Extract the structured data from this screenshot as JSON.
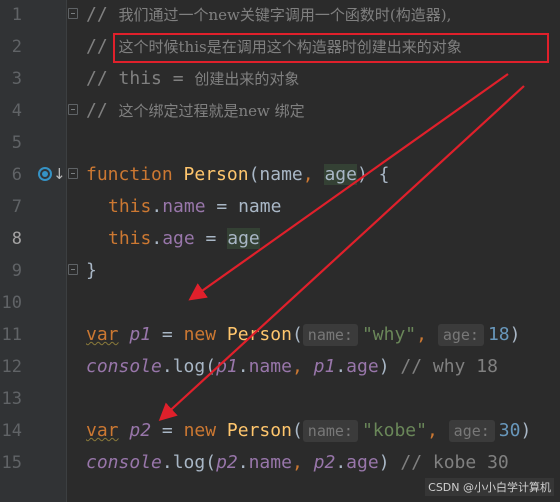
{
  "editor": {
    "lines": [
      {
        "n": "1",
        "c1": "// ",
        "t": "我们通过一个new关键字调用一个函数时(构造器),"
      },
      {
        "n": "2",
        "c1": "// ",
        "t": "这个时候this是在调用这个构造器时创建出来的对象"
      },
      {
        "n": "3",
        "c1": "// ",
        "c2": "this",
        "c3": " = ",
        "t": "创建出来的对象"
      },
      {
        "n": "4",
        "c1": "// ",
        "t": "这个绑定过程就是new 绑定"
      },
      {
        "n": "5"
      },
      {
        "n": "6",
        "kw": "function",
        "fn": "Person",
        "p1": "name",
        "p2": "age"
      },
      {
        "n": "7",
        "self": "this",
        "prop": "name",
        "val": "name"
      },
      {
        "n": "8",
        "self": "this",
        "prop": "age",
        "val": "age"
      },
      {
        "n": "9",
        "brace": "}"
      },
      {
        "n": "10"
      },
      {
        "n": "11",
        "kw": "var",
        "var": "p1",
        "newkw": "new",
        "cls": "Person",
        "hint1": "name:",
        "arg1": "\"why\"",
        "hint2": "age:",
        "arg2": "18"
      },
      {
        "n": "12",
        "obj": "console",
        "method": "log",
        "a": "p1",
        "pa": "name",
        "b": "p1",
        "pb": "age",
        "comment": "// why 18"
      },
      {
        "n": "13"
      },
      {
        "n": "14",
        "kw": "var",
        "var": "p2",
        "newkw": "new",
        "cls": "Person",
        "hint1": "name:",
        "arg1": "\"kobe\"",
        "hint2": "age:",
        "arg2": "30"
      },
      {
        "n": "15",
        "obj": "console",
        "method": "log",
        "a": "p2",
        "pa": "name",
        "b": "p2",
        "pb": "age",
        "comment": "// kobe 30"
      }
    ]
  },
  "watermark": "CSDN @小小白学计算机",
  "icons": {
    "override": "override-method-icon",
    "fold": "fold-marker-icon"
  },
  "colors": {
    "background": "#2b2b2b",
    "gutter": "#313335",
    "keyword": "#cc7832",
    "function": "#ffc66d",
    "string": "#6a8759",
    "number": "#6897bb",
    "property": "#9876aa",
    "comment": "#808080",
    "annotation": "#e0202b"
  }
}
